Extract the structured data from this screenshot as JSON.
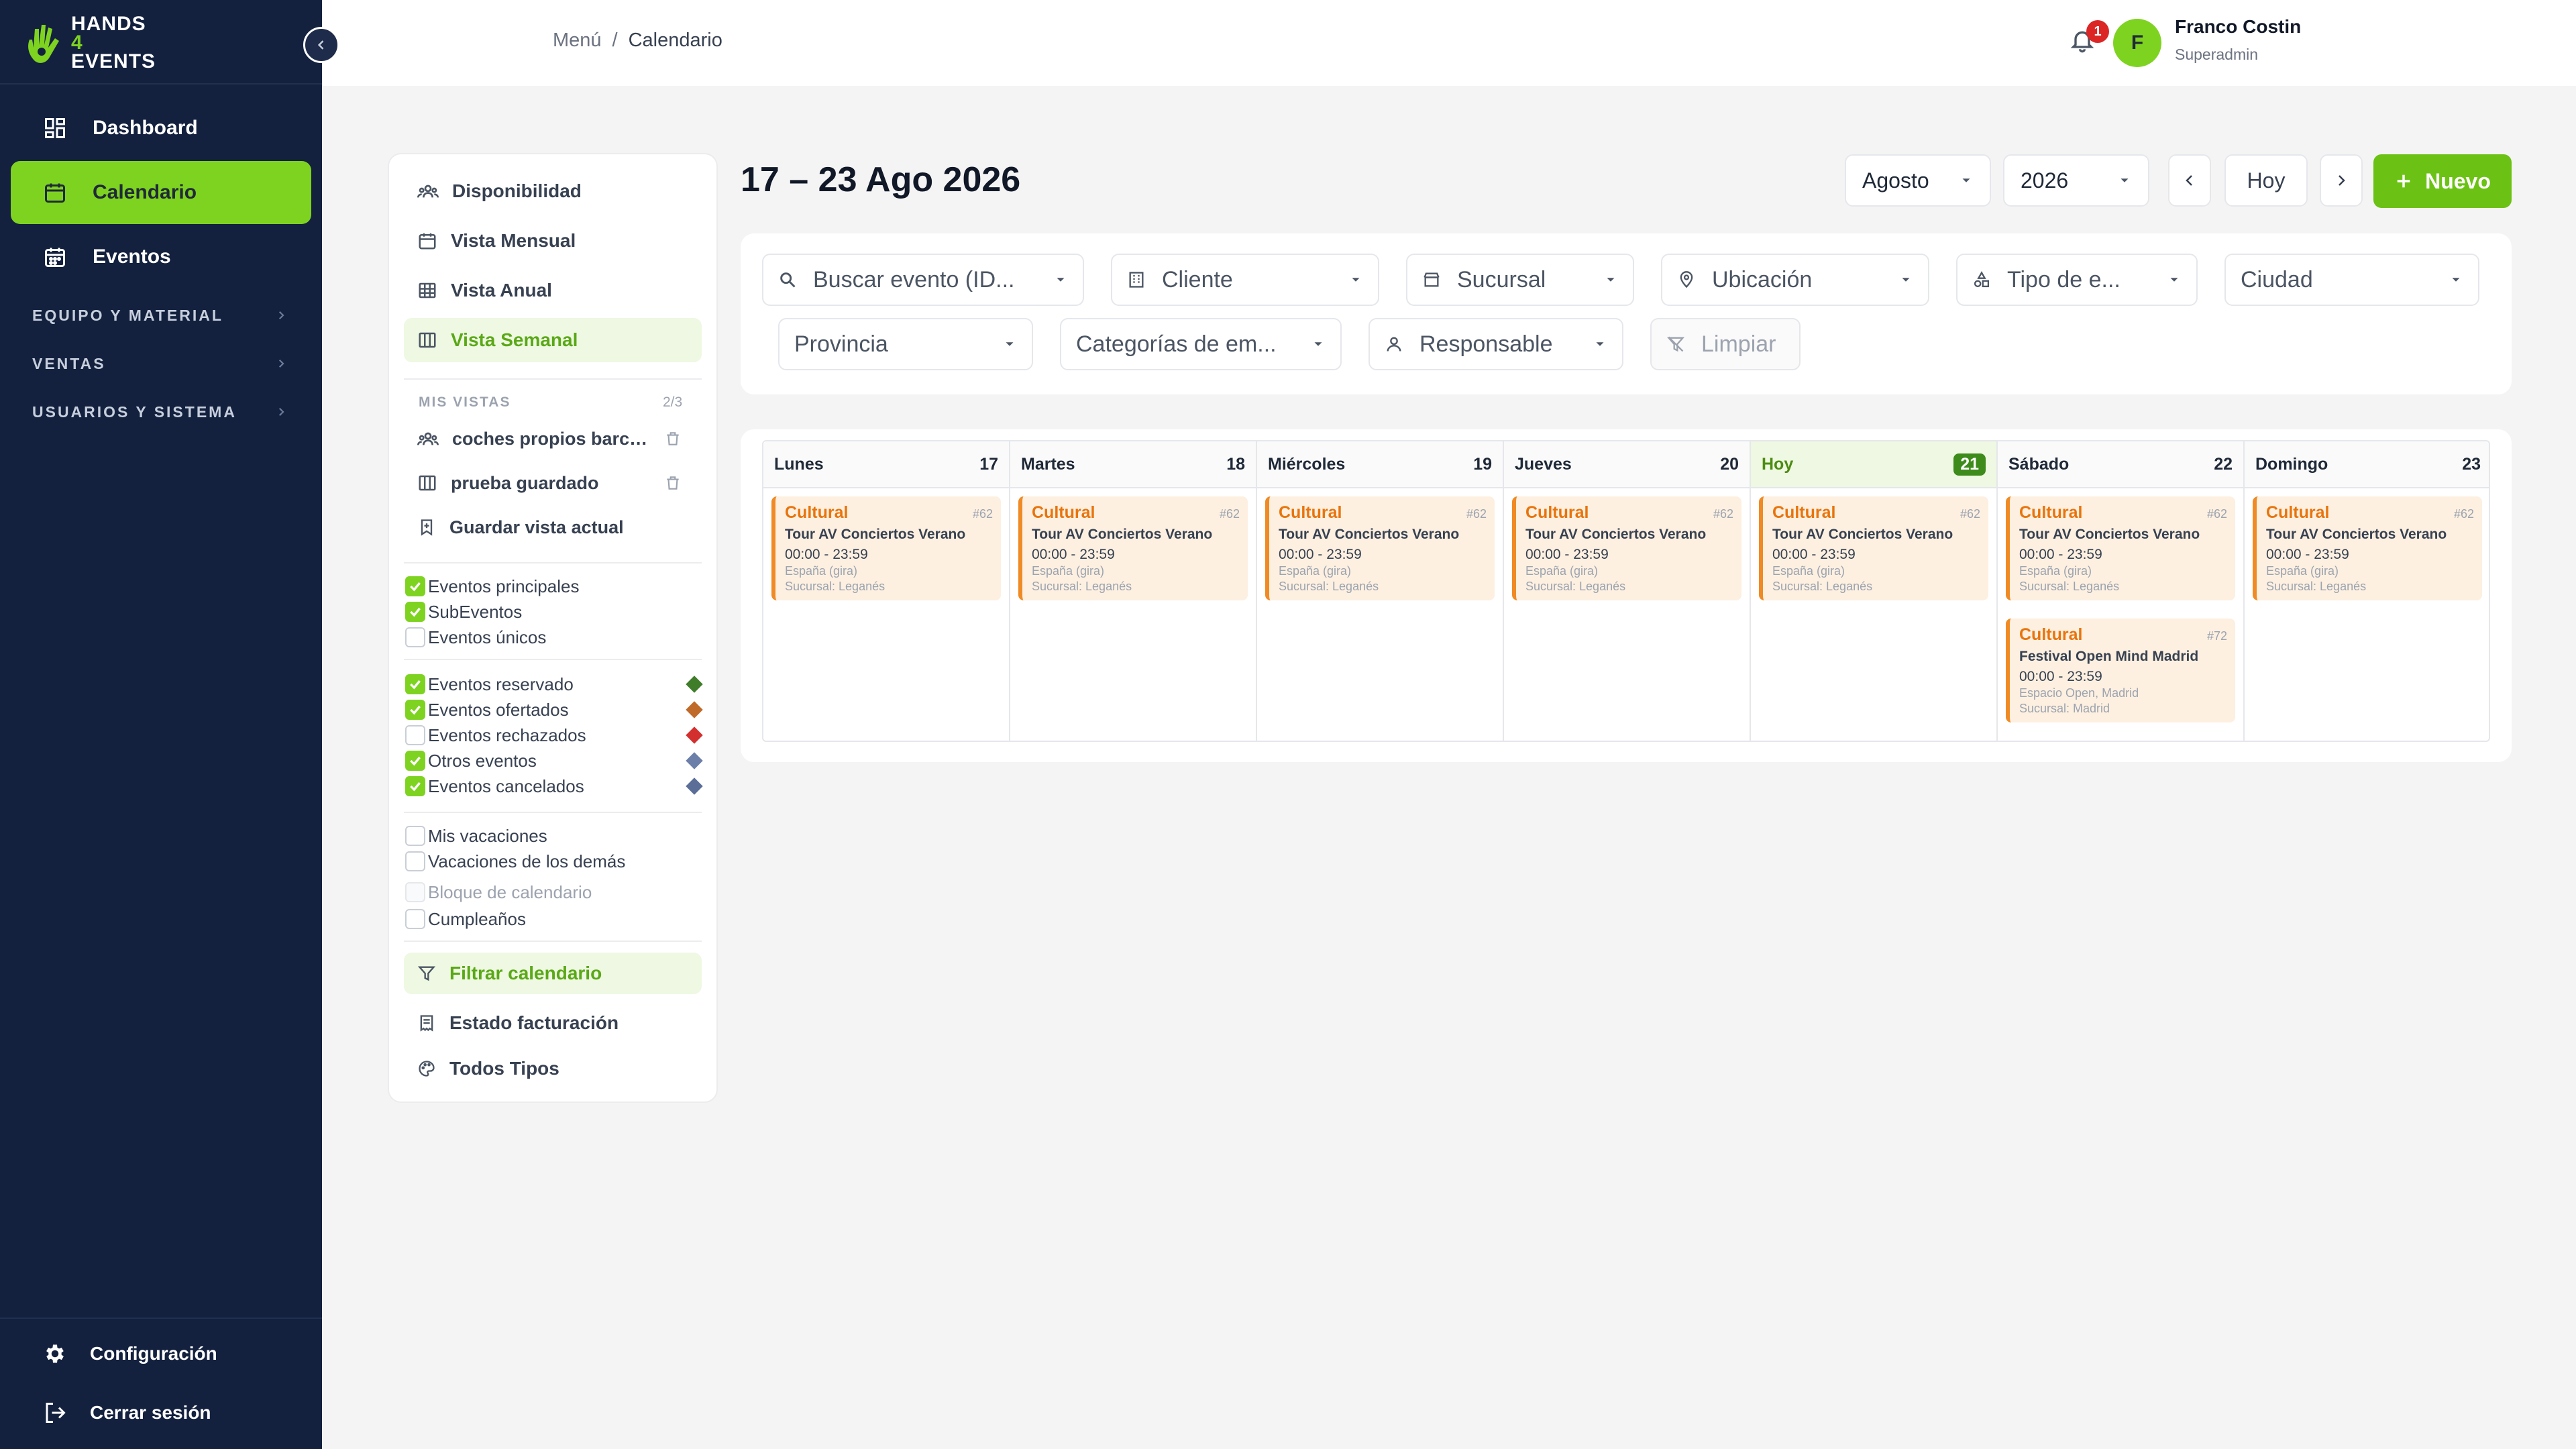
{
  "brand": {
    "line1": "HANDS",
    "four": "4",
    "line2": "EVENTS"
  },
  "nav": {
    "items": [
      {
        "label": "Dashboard"
      },
      {
        "label": "Calendario",
        "active": true
      },
      {
        "label": "Eventos"
      }
    ],
    "groups": [
      {
        "label": "EQUIPO Y MATERIAL"
      },
      {
        "label": "VENTAS"
      },
      {
        "label": "USUARIOS Y SISTEMA"
      }
    ],
    "bottom": [
      {
        "label": "Configuración"
      },
      {
        "label": "Cerrar sesión"
      }
    ]
  },
  "header": {
    "breadcrumb": [
      "Menú",
      "/",
      "Calendario"
    ],
    "notifications": "1",
    "avatar_initial": "F",
    "user_name": "Franco Costin",
    "user_role": "Superadmin"
  },
  "panel": {
    "views": [
      {
        "label": "Disponibilidad"
      },
      {
        "label": "Vista Mensual"
      },
      {
        "label": "Vista Anual"
      },
      {
        "label": "Vista Semanal",
        "selected": true
      }
    ],
    "my_views_label": "MIS VISTAS",
    "my_views_count": "2/3",
    "saved_views": [
      {
        "label": "coches propios barcel..."
      },
      {
        "label": "prueba guardado"
      }
    ],
    "save_current": "Guardar vista actual",
    "event_checks": [
      {
        "label": "Eventos principales",
        "checked": true
      },
      {
        "label": "SubEventos",
        "checked": true
      },
      {
        "label": "Eventos únicos",
        "checked": false
      }
    ],
    "status_checks": [
      {
        "label": "Eventos reservado",
        "checked": true,
        "color": "#3f7d2a"
      },
      {
        "label": "Eventos ofertados",
        "checked": true,
        "color": "#c06a2a"
      },
      {
        "label": "Eventos rechazados",
        "checked": false,
        "color": "#d32f2f"
      },
      {
        "label": "Otros eventos",
        "checked": true,
        "color": "#6b7fa8"
      },
      {
        "label": "Eventos cancelados",
        "checked": true,
        "color": "#5a6e98"
      }
    ],
    "other_checks": [
      {
        "label": "Mis vacaciones",
        "checked": false
      },
      {
        "label": "Vacaciones de los demás",
        "checked": false
      },
      {
        "label": "Bloque de calendario",
        "checked": false,
        "disabled": true
      },
      {
        "label": "Cumpleaños",
        "checked": false
      }
    ],
    "filter_calendar": "Filtrar calendario",
    "billing_state": "Estado facturación",
    "all_types": "Todos Tipos"
  },
  "main": {
    "range_title": "17 – 23 Ago 2026",
    "month": "Agosto",
    "year": "2026",
    "today_btn": "Hoy",
    "new_btn": "Nuevo"
  },
  "filters": {
    "search": "Buscar evento (ID...",
    "client": "Cliente",
    "branch": "Sucursal",
    "location": "Ubicación",
    "type": "Tipo de e...",
    "city": "Ciudad",
    "province": "Provincia",
    "categories": "Categorías de em...",
    "responsible": "Responsable",
    "clear": "Limpiar"
  },
  "week": {
    "days": [
      {
        "name": "Lunes",
        "num": "17",
        "today": false
      },
      {
        "name": "Martes",
        "num": "18",
        "today": false
      },
      {
        "name": "Miércoles",
        "num": "19",
        "today": false
      },
      {
        "name": "Jueves",
        "num": "20",
        "today": false
      },
      {
        "name": "Hoy",
        "num": "21",
        "today": true
      },
      {
        "name": "Sábado",
        "num": "22",
        "today": false
      },
      {
        "name": "Domingo",
        "num": "23",
        "today": false
      }
    ],
    "event_main": {
      "type": "Cultural",
      "id": "#62",
      "title": "Tour AV Conciertos Verano",
      "time": "00:00 - 23:59",
      "location": "España (gira)",
      "branch": "Sucursal: Leganés"
    },
    "event_extra": {
      "type": "Cultural",
      "id": "#72",
      "title": "Festival Open Mind Madrid",
      "time": "00:00 - 23:59",
      "location": "Espacio Open, Madrid",
      "branch": "Sucursal: Madrid"
    }
  }
}
